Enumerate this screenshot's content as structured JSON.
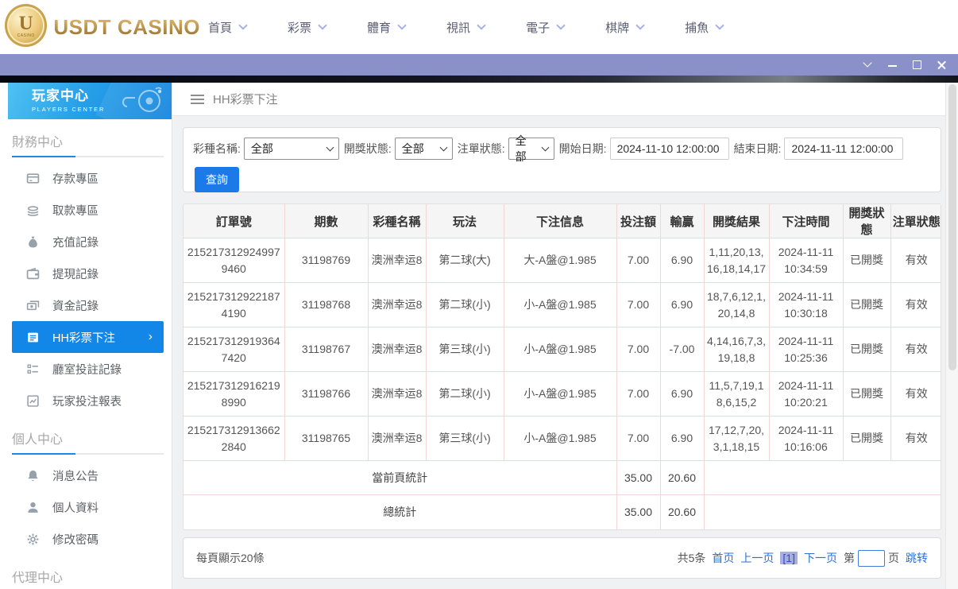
{
  "header": {
    "brand": "USDT CASINO",
    "coin_letter": "U",
    "coin_sub": "CASINO",
    "nav": [
      {
        "label": "首頁"
      },
      {
        "label": "彩票"
      },
      {
        "label": "體育"
      },
      {
        "label": "視訊"
      },
      {
        "label": "電子"
      },
      {
        "label": "棋牌"
      },
      {
        "label": "捕魚"
      }
    ]
  },
  "sidebar": {
    "title": "玩家中心",
    "subtitle": "PLAYERS CENTER",
    "sections": [
      {
        "title": "財務中心",
        "items": [
          {
            "label": "存款專區",
            "icon": "deposit-icon"
          },
          {
            "label": "取款專區",
            "icon": "withdraw-icon"
          },
          {
            "label": "充值記錄",
            "icon": "recharge-record-icon"
          },
          {
            "label": "提現記錄",
            "icon": "withdrawal-record-icon"
          },
          {
            "label": "資金記錄",
            "icon": "funds-record-icon"
          },
          {
            "label": "HH彩票下注",
            "icon": "lottery-bet-icon",
            "active": true
          },
          {
            "label": "廳室投註記錄",
            "icon": "hall-bet-record-icon"
          },
          {
            "label": "玩家投注報表",
            "icon": "player-report-icon"
          }
        ]
      },
      {
        "title": "個人中心",
        "items": [
          {
            "label": "消息公告",
            "icon": "bell-icon"
          },
          {
            "label": "個人資料",
            "icon": "person-icon"
          },
          {
            "label": "修改密碼",
            "icon": "gear-icon"
          }
        ]
      },
      {
        "title": "代理中心",
        "items": []
      }
    ]
  },
  "breadcrumb": {
    "title": "HH彩票下注"
  },
  "filters": {
    "lottery_label": "彩種名稱:",
    "lottery_value": "全部",
    "draw_status_label": "開獎狀態:",
    "draw_status_value": "全部",
    "order_status_label": "注單狀態:",
    "order_status_value": "全部",
    "start_label": "開始日期:",
    "start_value": "2024-11-10 12:00:00",
    "end_label": "結束日期:",
    "end_value": "2024-11-11 12:00:00",
    "search_label": "查詢"
  },
  "table": {
    "headers": [
      "訂單號",
      "期數",
      "彩種名稱",
      "玩法",
      "下注信息",
      "投注額",
      "輸贏",
      "開獎結果",
      "下注時間",
      "開獎狀態",
      "注單狀態"
    ],
    "rows": [
      [
        "2152173129249979460",
        "31198769",
        "澳洲幸运8",
        "第二球(大)",
        "大-A盤@1.985",
        "7.00",
        "6.90",
        "1,11,20,13,16,18,14,17",
        "2024-11-11 10:34:59",
        "已開獎",
        "有效"
      ],
      [
        "2152173129221874190",
        "31198768",
        "澳洲幸运8",
        "第二球(小)",
        "小-A盤@1.985",
        "7.00",
        "6.90",
        "18,7,6,12,1,20,14,8",
        "2024-11-11 10:30:18",
        "已開獎",
        "有效"
      ],
      [
        "2152173129193647420",
        "31198767",
        "澳洲幸运8",
        "第三球(小)",
        "小-A盤@1.985",
        "7.00",
        "-7.00",
        "4,14,16,7,3,19,18,8",
        "2024-11-11 10:25:36",
        "已開獎",
        "有效"
      ],
      [
        "2152173129162198990",
        "31198766",
        "澳洲幸运8",
        "第二球(小)",
        "小-A盤@1.985",
        "7.00",
        "6.90",
        "11,5,7,19,18,6,15,2",
        "2024-11-11 10:20:21",
        "已開獎",
        "有效"
      ],
      [
        "2152173129136622840",
        "31198765",
        "澳洲幸运8",
        "第三球(小)",
        "小-A盤@1.985",
        "7.00",
        "6.90",
        "17,12,7,20,3,1,18,15",
        "2024-11-11 10:16:06",
        "已開獎",
        "有效"
      ]
    ],
    "summary_rows": [
      {
        "label": "當前頁統計",
        "bet_total": "35.00",
        "winloss_total": "20.60"
      },
      {
        "label": "總統計",
        "bet_total": "35.00",
        "winloss_total": "20.60"
      }
    ]
  },
  "pagination": {
    "page_size_text": "每頁顯示20條",
    "total_text": "共5条",
    "first_label": "首页",
    "prev_label": "上一页",
    "current_label": "[1]",
    "next_label": "下一页",
    "jump_prefix": "第",
    "jump_suffix": "页",
    "jump_label": "跳转"
  },
  "colors": {
    "accent_blue": "#1287e8",
    "titlebar_purple": "#8a91c9",
    "table_border_pink": "#f0d6d6",
    "brand_gold": "#c9a24c",
    "link_blue": "#2a70d8"
  }
}
